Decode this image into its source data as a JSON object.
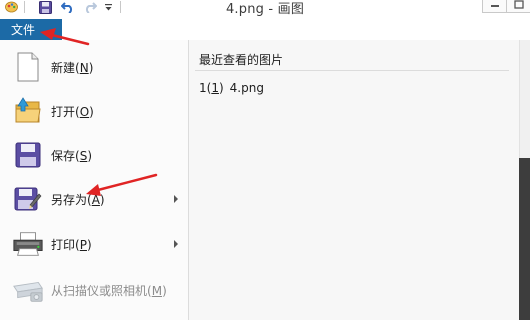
{
  "window": {
    "title": "4.png - 画图"
  },
  "quick_access": {
    "icons": [
      "paint-app-icon",
      "save-icon",
      "undo-icon",
      "redo-icon",
      "customize-dropdown-icon"
    ]
  },
  "file_tab": {
    "label": "文件"
  },
  "menu": {
    "items": [
      {
        "label": "新建",
        "key": "N",
        "icon": "new-document-icon",
        "has_submenu": false,
        "enabled": true
      },
      {
        "label": "打开",
        "key": "O",
        "icon": "open-folder-icon",
        "has_submenu": false,
        "enabled": true
      },
      {
        "label": "保存",
        "key": "S",
        "icon": "save-disk-icon",
        "has_submenu": false,
        "enabled": true
      },
      {
        "label": "另存为",
        "key": "A",
        "icon": "save-as-icon",
        "has_submenu": true,
        "enabled": true
      },
      {
        "label": "打印",
        "key": "P",
        "icon": "printer-icon",
        "has_submenu": true,
        "enabled": true
      },
      {
        "label": "从扫描仪或照相机",
        "key": "M",
        "icon": "scanner-icon",
        "has_submenu": false,
        "enabled": false
      }
    ]
  },
  "recent": {
    "header": "最近查看的图片",
    "items": [
      {
        "index": "1",
        "key": "1",
        "name": "4.png"
      }
    ]
  },
  "colors": {
    "file_tab_bg": "#1c6aa6",
    "annotation_arrow": "#e02424",
    "pane_bg": "#f7f7f7",
    "menu_bg": "#fbfbfb"
  }
}
